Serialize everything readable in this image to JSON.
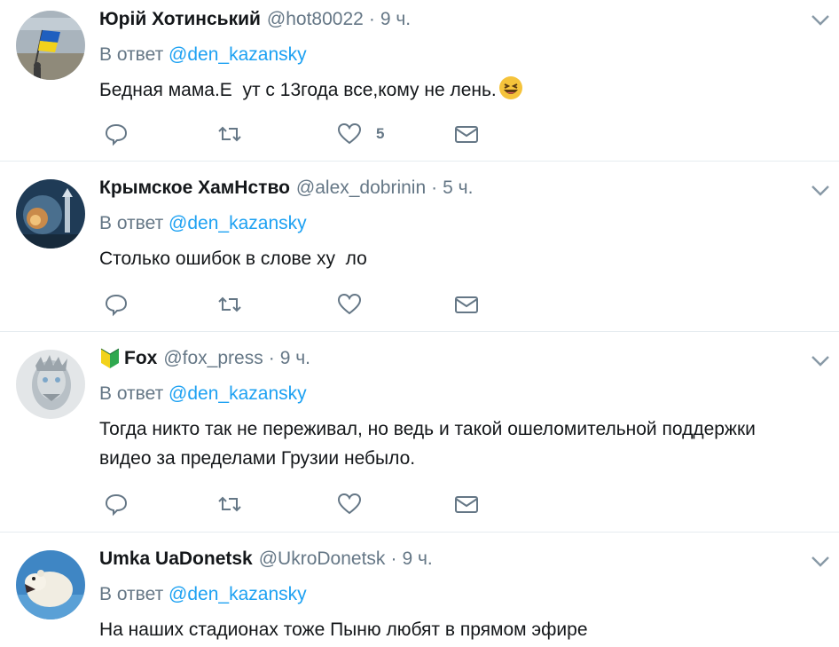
{
  "reply_prefix": "В ответ",
  "tweets": [
    {
      "name": "Юрій Хотинський",
      "handle": "@hot80022",
      "time": "9 ч.",
      "reply_to": "@den_kazansky",
      "text": "Бедная мама.Е  ут с 13года все,кому не лень.",
      "like_count": "5",
      "avatar_icon": "flag-avatar-icon"
    },
    {
      "name": "Крымское ХамНство",
      "handle": "@alex_dobrinin",
      "time": "5 ч.",
      "reply_to": "@den_kazansky",
      "text": "Столько ошибок в слове ху  ло",
      "like_count": "",
      "avatar_icon": "night-sky-avatar-icon"
    },
    {
      "name": "Fox",
      "handle": "@fox_press",
      "time": "9 ч.",
      "reply_to": "@den_kazansky",
      "text": "Тогда никто так не переживал, но ведь и такой ошеломительной поддержки\nвидео за пределами Грузии небыло.",
      "like_count": "",
      "avatar_icon": "white-walker-avatar-icon"
    },
    {
      "name": "Umka UaDonetsk",
      "handle": "@UkroDonetsk",
      "time": "9 ч.",
      "reply_to": "@den_kazansky",
      "text": "На наших стадионах тоже Пыню любят в прямом эфире",
      "like_count": "",
      "avatar_icon": "polar-bear-avatar-icon"
    }
  ],
  "colors": {
    "link": "#1da1f2",
    "secondary_text": "#657786",
    "border": "#e6ecf0"
  }
}
